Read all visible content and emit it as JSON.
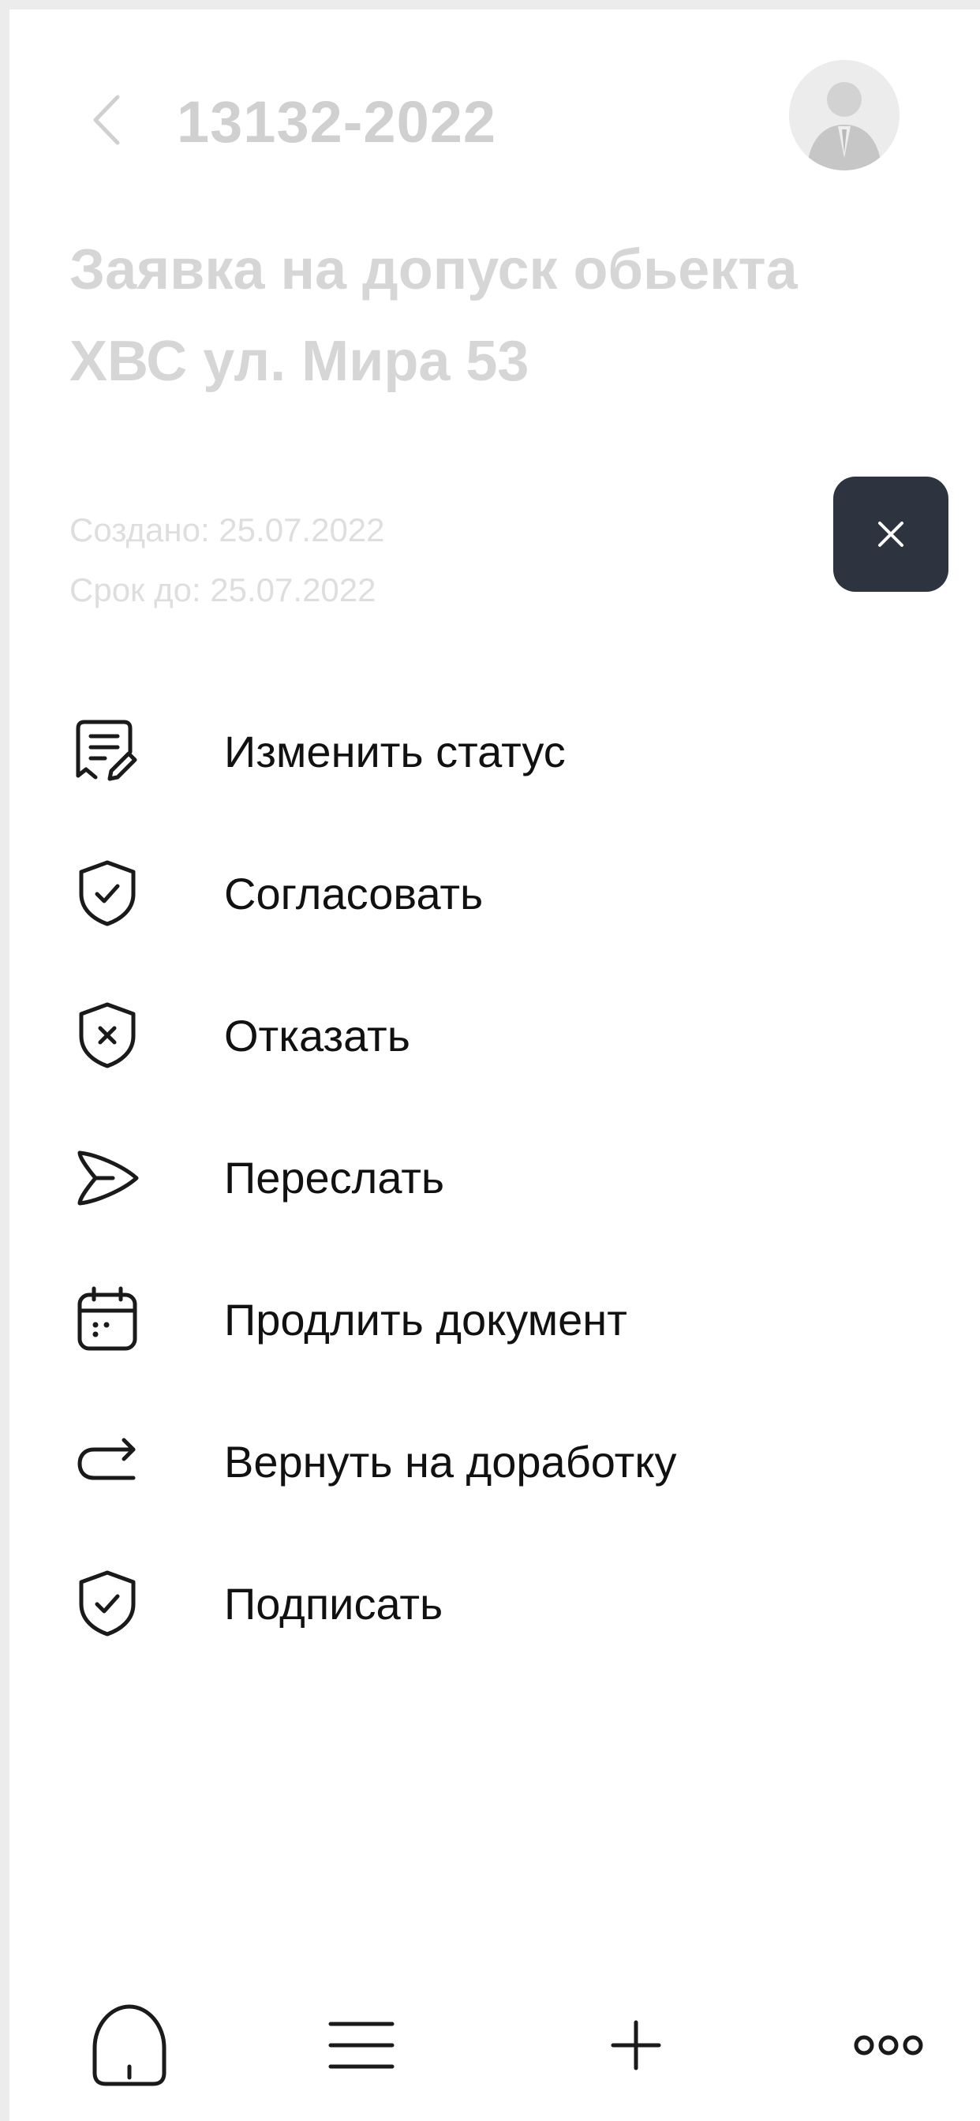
{
  "header": {
    "doc_number": "13132-2022",
    "title": "Заявка на допуск обьекта ХВС ул. Мира 53",
    "created": "Создано: 25.07.2022",
    "deadline": "Срок до: 25.07.2022"
  },
  "actions": [
    {
      "label": "Изменить статус",
      "icon": "document-edit-icon"
    },
    {
      "label": "Согласовать",
      "icon": "shield-check-icon"
    },
    {
      "label": "Отказать",
      "icon": "shield-x-icon"
    },
    {
      "label": "Переслать",
      "icon": "send-icon"
    },
    {
      "label": "Продлить документ",
      "icon": "calendar-icon"
    },
    {
      "label": "Вернуть на доработку",
      "icon": "return-arrow-icon"
    },
    {
      "label": "Подписать",
      "icon": "shield-check-icon"
    }
  ],
  "bottom_nav": [
    "home-icon",
    "menu-icon",
    "plus-icon",
    "more-icon"
  ],
  "colors": {
    "accent_dark": "#2d3440",
    "faded_text": "#d0d0d0",
    "icon_stroke": "#1a1a1a"
  }
}
